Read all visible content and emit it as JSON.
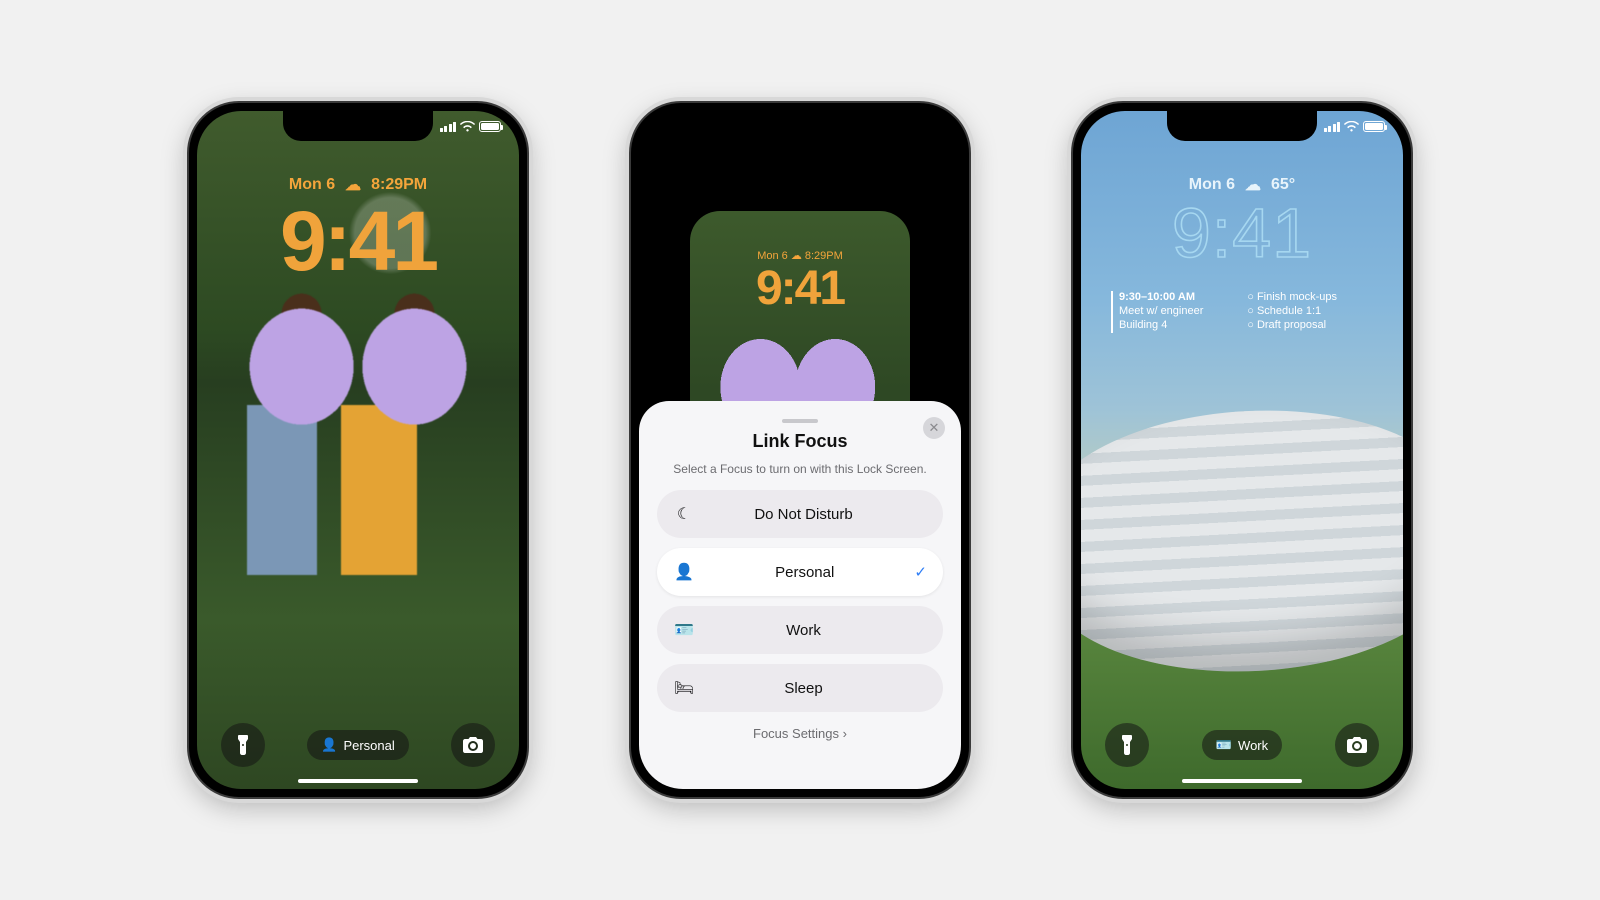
{
  "phone1": {
    "date": "Mon 6",
    "weather_glyph": "☁︎",
    "time_small": "8:29PM",
    "clock": "9:41",
    "focus_chip": "Personal",
    "accent": "#f0a33b"
  },
  "phone2": {
    "mini_date": "Mon 6   ☁︎   8:29PM",
    "mini_clock": "9:41",
    "sheet": {
      "title": "Link Focus",
      "subtitle": "Select a Focus to turn on with this Lock Screen.",
      "options": [
        {
          "icon": "moon-icon",
          "glyph": "☾",
          "label": "Do Not Disturb",
          "selected": false,
          "icon_color": "#121214"
        },
        {
          "icon": "person-icon",
          "glyph": "👤",
          "label": "Personal",
          "selected": true,
          "icon_color": "#9d5edb"
        },
        {
          "icon": "badge-icon",
          "glyph": "🪪",
          "label": "Work",
          "selected": false,
          "icon_color": "#121214"
        },
        {
          "icon": "bed-icon",
          "glyph": "🛏",
          "label": "Sleep",
          "selected": false,
          "icon_color": "#121214"
        }
      ],
      "footer": "Focus Settings"
    }
  },
  "phone3": {
    "date": "Mon 6",
    "weather_glyph": "☁︎",
    "temp": "65°",
    "clock": "9:41",
    "focus_chip": "Work",
    "widgets": {
      "calendar": {
        "time": "9:30–10:00 AM",
        "title": "Meet w/ engineer",
        "location": "Building 4"
      },
      "reminders": [
        "Finish mock-ups",
        "Schedule 1:1",
        "Draft proposal"
      ]
    }
  }
}
